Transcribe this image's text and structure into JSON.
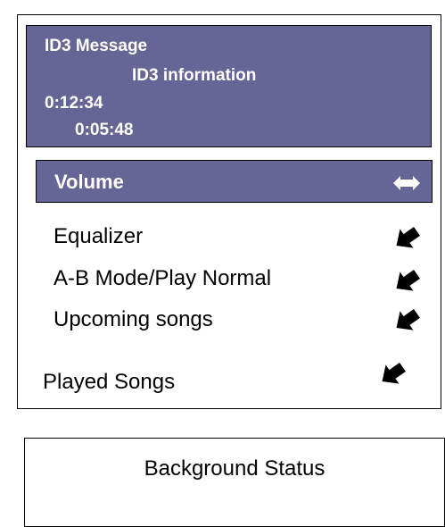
{
  "id3": {
    "message": "ID3 Message",
    "information": "ID3 information",
    "elapsed_time": "0:12:34",
    "remaining_time": "0:05:48"
  },
  "menu": {
    "selected": {
      "label": "Volume",
      "icon": "double-arrow-icon"
    },
    "items": [
      {
        "label": "Equalizer",
        "icon": "arrow-icon"
      },
      {
        "label": "A-B Mode/Play Normal",
        "icon": "arrow-icon"
      },
      {
        "label": "Upcoming songs",
        "icon": "arrow-icon"
      },
      {
        "label": "Played Songs",
        "icon": "arrow-icon"
      }
    ]
  },
  "status": {
    "label": "Background Status"
  },
  "colors": {
    "panel_fill": "#656596",
    "text_on_panel": "#ffffff",
    "border": "#000000"
  }
}
